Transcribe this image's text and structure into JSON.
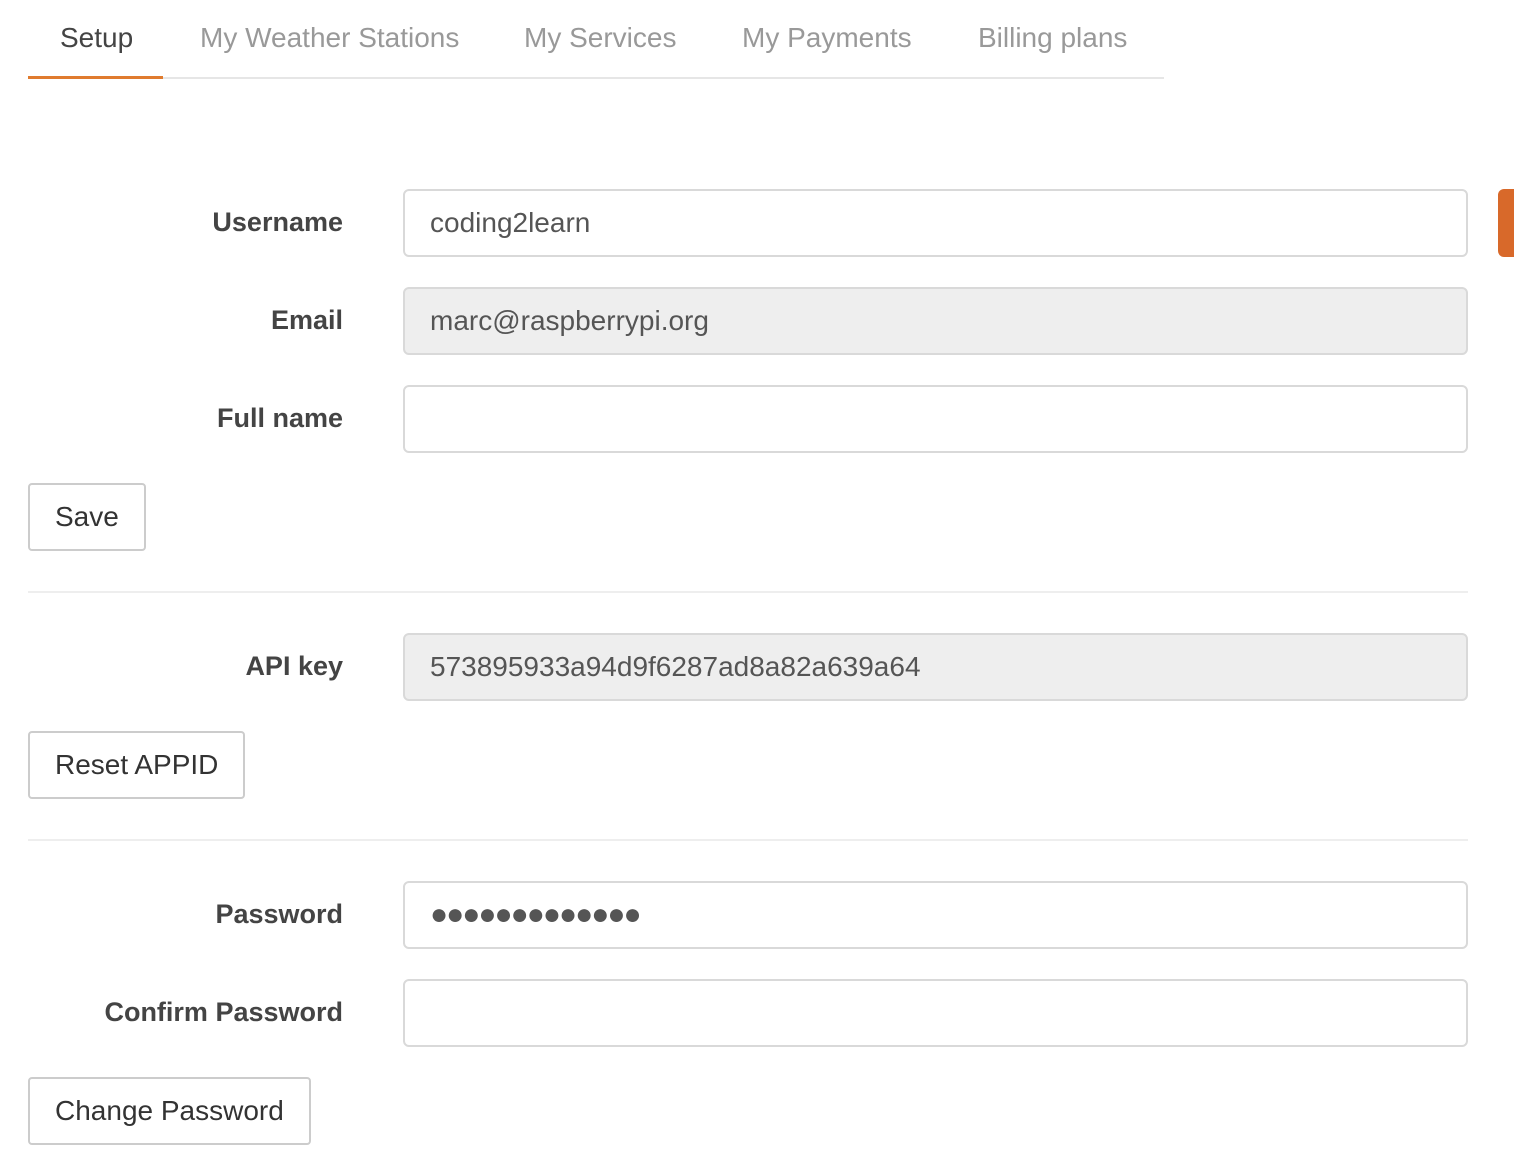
{
  "tabs": [
    {
      "label": "Setup",
      "active": true
    },
    {
      "label": "My Weather Stations",
      "active": false
    },
    {
      "label": "My Services",
      "active": false
    },
    {
      "label": "My Payments",
      "active": false
    },
    {
      "label": "Billing plans",
      "active": false
    }
  ],
  "profile": {
    "username_label": "Username",
    "username_value": "coding2learn",
    "email_label": "Email",
    "email_value": "marc@raspberrypi.org",
    "fullname_label": "Full name",
    "fullname_value": "",
    "save_label": "Save"
  },
  "api": {
    "label": "API key",
    "value": "573895933a94d9f6287ad8a82a639a64",
    "reset_label": "Reset APPID"
  },
  "password": {
    "label": "Password",
    "masked_value": "●●●●●●●●●●●●●",
    "confirm_label": "Confirm Password",
    "confirm_value": "",
    "change_label": "Change Password"
  },
  "colors": {
    "accent": "#e07b2e",
    "side_accent": "#d8692a",
    "readonly_bg": "#eeeeee"
  }
}
